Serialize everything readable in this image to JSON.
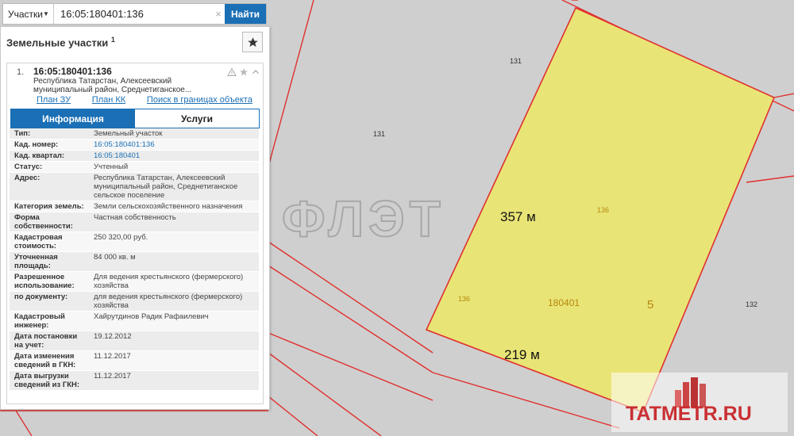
{
  "search": {
    "type_label": "Участки",
    "value": "16:05:180401:136",
    "clear": "×",
    "button": "Найти"
  },
  "panel": {
    "title": "Земельные участки",
    "count": "1"
  },
  "result": {
    "number": "1.",
    "cad_number": "16:05:180401:136",
    "address_line1": "Республика Татарстан, Алексеевский",
    "address_line2": "муниципальный район, Среднетиганское...",
    "links": {
      "plan_zu": "План ЗУ →",
      "plan_kk": "План КК →",
      "search_within": "Поиск в границах объекта →"
    },
    "tabs": {
      "info": "Информация",
      "services": "Услуги"
    },
    "properties": [
      {
        "key": [
          "Тип:"
        ],
        "val": [
          "Земельный участок"
        ],
        "link": false
      },
      {
        "key": [
          "Кад. номер:"
        ],
        "val": [
          "16:05:180401:136"
        ],
        "link": true
      },
      {
        "key": [
          "Кад. квартал:"
        ],
        "val": [
          "16:05:180401"
        ],
        "link": true
      },
      {
        "key": [
          "Статус:"
        ],
        "val": [
          "Учтенный"
        ],
        "link": false
      },
      {
        "key": [
          "Адрес:"
        ],
        "val": [
          "Республика Татарстан, Алексеевский",
          "муниципальный район, Среднетиганское",
          "сельское поселение"
        ],
        "link": false
      },
      {
        "key": [
          "Категория земель:"
        ],
        "val": [
          "Земли сельскохозяйственного назначения"
        ],
        "link": false
      },
      {
        "key": [
          "Форма",
          "собственности:"
        ],
        "val": [
          "Частная собственность"
        ],
        "link": false
      },
      {
        "key": [
          "Кадастровая",
          "стоимость:"
        ],
        "val": [
          "250 320,00 руб."
        ],
        "link": false
      },
      {
        "key": [
          "Уточненная",
          "площадь:"
        ],
        "val": [
          "84 000 кв. м"
        ],
        "link": false
      },
      {
        "key": [
          "Разрешенное",
          "использование:"
        ],
        "val": [
          "Для ведения крестьянского (фермерского)",
          "хозяйства"
        ],
        "link": false
      },
      {
        "key": [
          "по документу:"
        ],
        "val": [
          "для ведения крестьянского (фермерского)",
          "хозяйства"
        ],
        "link": false
      },
      {
        "key": [
          "Кадастровый",
          "инженер:"
        ],
        "val": [
          "Хайрутдинов Радик Рафаилевич"
        ],
        "link": false
      },
      {
        "key": [
          "Дата постановки",
          "на учет:"
        ],
        "val": [
          "19.12.2012"
        ],
        "link": false
      },
      {
        "key": [
          "Дата изменения",
          "сведений в ГКН:"
        ],
        "val": [
          "11.12.2017"
        ],
        "link": false
      },
      {
        "key": [
          "Дата выгрузки",
          "сведений из ГКН:"
        ],
        "val": [
          "11.12.2017"
        ],
        "link": false
      }
    ]
  },
  "map": {
    "parcel_color": "#e9e476",
    "boundary_color": "#e0302e",
    "label_color": "#b5870e",
    "labels": {
      "l131a": "131",
      "l131b": "131",
      "l136a": "136",
      "l136b": "136",
      "l132": "132",
      "quarter": "180401",
      "five": "5"
    },
    "dims": {
      "side": "357 м",
      "bottom": "219 м"
    },
    "watermark_logo": "ФЛЭТ"
  },
  "watermark": {
    "text": "TATMETR.RU"
  }
}
